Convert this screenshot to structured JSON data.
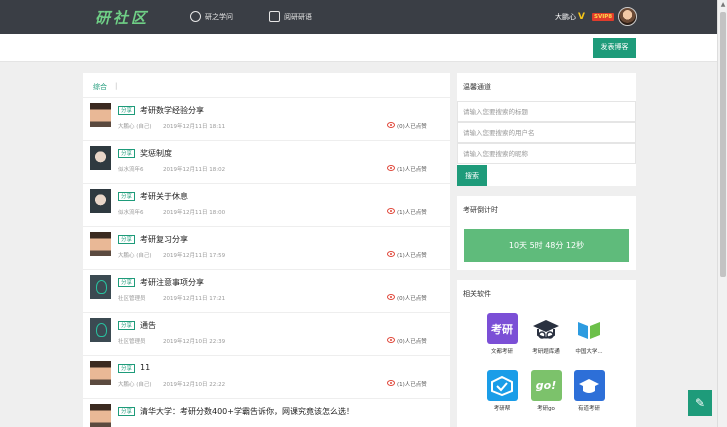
{
  "logo": "研社区",
  "nav": [
    {
      "label": "研之学问",
      "icon": "compass-icon"
    },
    {
      "label": "阅研研语",
      "icon": "book-icon"
    }
  ],
  "user": {
    "name": "大鹏心",
    "v_badge": "V",
    "vip_badge": "SVIP8"
  },
  "toolbar": {
    "post_label": "发表博客"
  },
  "filter": {
    "label": "综合",
    "separator": "|"
  },
  "posts": [
    {
      "tag": "分享",
      "title": "考研数学经验分享",
      "author": "大鹏心 (自己)",
      "date": "2019年12月11日 18:11",
      "likes": "(0)人已点赞",
      "avatar": "boy"
    },
    {
      "tag": "分享",
      "title": "奖惩制度",
      "author": "似水流年6",
      "date": "2019年12月11日 18:02",
      "likes": "(1)人已点赞",
      "avatar": "girl"
    },
    {
      "tag": "分享",
      "title": "考研关于休息",
      "author": "似水流年6",
      "date": "2019年12月11日 18:00",
      "likes": "(1)人已点赞",
      "avatar": "girl"
    },
    {
      "tag": "分享",
      "title": "考研复习分享",
      "author": "大鹏心 (自己)",
      "date": "2019年12月11日 17:59",
      "likes": "(1)人已点赞",
      "avatar": "boy"
    },
    {
      "tag": "分享",
      "title": "考研注意事项分享",
      "author": "社区管理员",
      "date": "2019年12月11日 17:21",
      "likes": "(0)人已点赞",
      "avatar": "logo"
    },
    {
      "tag": "分享",
      "title": "通告",
      "author": "社区管理员",
      "date": "2019年12月10日 22:39",
      "likes": "(0)人已点赞",
      "avatar": "logo"
    },
    {
      "tag": "分享",
      "title": "11",
      "author": "大鹏心 (自己)",
      "date": "2019年12月10日 22:22",
      "likes": "(1)人已点赞",
      "avatar": "boy"
    },
    {
      "tag": "分享",
      "title": "清华大学：考研分数400+学霸告诉你，网课究竟该怎么选！",
      "author": "",
      "date": "",
      "likes": "",
      "avatar": "boy"
    }
  ],
  "search": {
    "title": "温馨通道",
    "placeholders": [
      "请输入您要搜索的标题",
      "请输入您要搜索的用户名",
      "请输入您要搜索的昵称"
    ],
    "button": "搜索"
  },
  "countdown": {
    "title": "考研倒计时",
    "value": "10天 5时 48分 12秒"
  },
  "apps": {
    "title": "相关软件",
    "items": [
      {
        "name": "文都考研",
        "icon_text": "考研",
        "sub": "文都考研",
        "color": "#7b4fd6"
      },
      {
        "name": "考研题库通",
        "icon_text": "",
        "color": "#ffffff"
      },
      {
        "name": "中国大学...",
        "icon_text": "",
        "color": "#ffffff"
      },
      {
        "name": "考研帮",
        "icon_text": "",
        "color": "#1a9de8"
      },
      {
        "name": "考研go",
        "icon_text": "go!",
        "color": "#7cc26b"
      },
      {
        "name": "有道考研",
        "icon_text": "",
        "color": "#2d6fd8"
      }
    ]
  }
}
